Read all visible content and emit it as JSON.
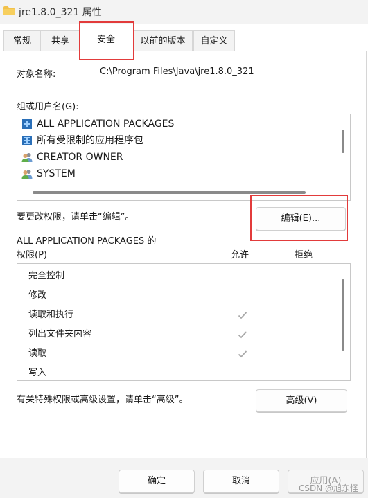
{
  "window": {
    "title": "jre1.8.0_321 属性"
  },
  "tabs": [
    {
      "label": "常规"
    },
    {
      "label": "共享"
    },
    {
      "label": "安全"
    },
    {
      "label": "以前的版本"
    },
    {
      "label": "自定义"
    }
  ],
  "security": {
    "object_label": "对象名称:",
    "object_value": "C:\\Program Files\\Java\\jre1.8.0_321",
    "group_label": "组或用户名(G):",
    "groups": [
      {
        "name": "ALL APPLICATION PACKAGES",
        "icon": "app-package-icon"
      },
      {
        "name": "所有受限制的应用程序包",
        "icon": "app-package-icon"
      },
      {
        "name": "CREATOR OWNER",
        "icon": "users-icon"
      },
      {
        "name": "SYSTEM",
        "icon": "users-icon"
      }
    ],
    "edit_hint": "要更改权限，请单击“编辑”。",
    "edit_button": "编辑(E)...",
    "perm_title": "ALL APPLICATION PACKAGES 的",
    "perm_subtitle": "权限(P)",
    "allow_header": "允许",
    "deny_header": "拒绝",
    "permissions": [
      {
        "name": "完全控制",
        "allow": false
      },
      {
        "name": "修改",
        "allow": false
      },
      {
        "name": "读取和执行",
        "allow": true
      },
      {
        "name": "列出文件夹内容",
        "allow": true
      },
      {
        "name": "读取",
        "allow": true
      },
      {
        "name": "写入",
        "allow": false
      }
    ],
    "advanced_hint": "有关特殊权限或高级设置，请单击“高级”。",
    "advanced_button": "高级(V)"
  },
  "footer": {
    "ok": "确定",
    "cancel": "取消",
    "apply": "应用(A)",
    "watermark": "CSDN @旭东怪"
  },
  "colors": {
    "highlight": "#e23b3b",
    "check": "#a8a8a8"
  }
}
